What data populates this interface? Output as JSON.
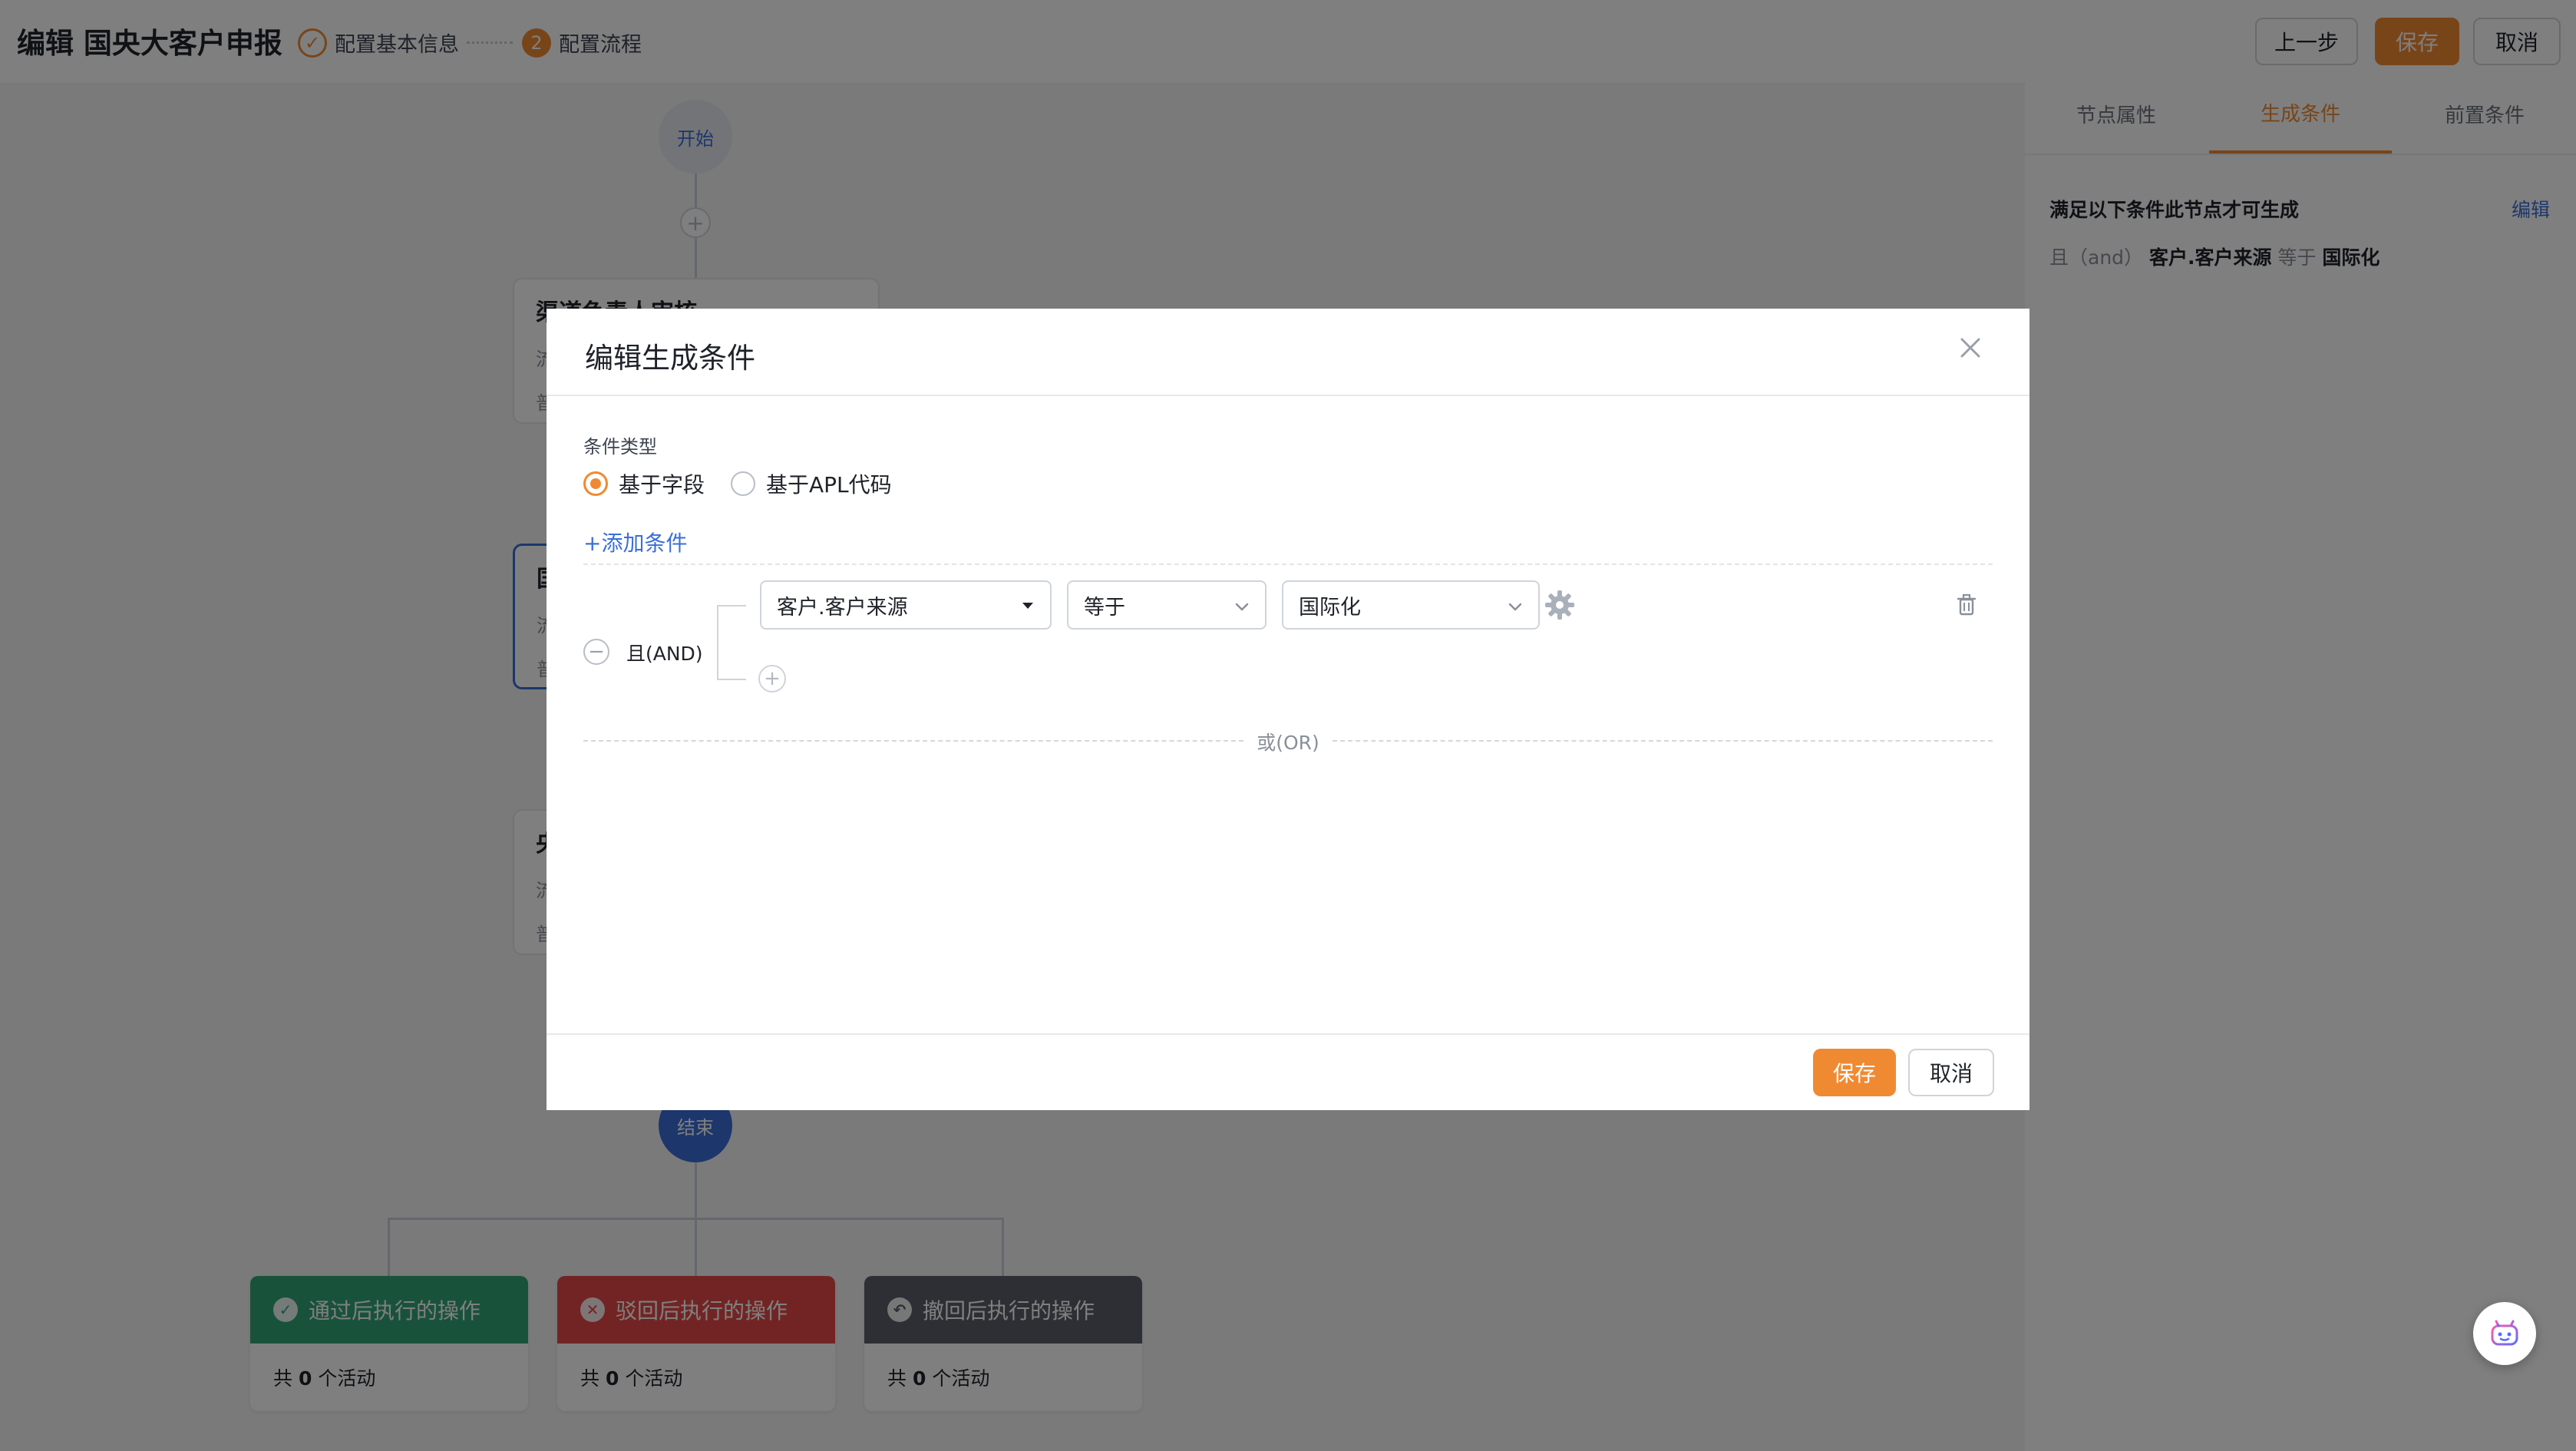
{
  "header": {
    "title": "编辑 国央大客户申报",
    "steps": [
      {
        "label": "配置基本信息",
        "marker": "✓"
      },
      {
        "label": "配置流程",
        "marker": "2"
      }
    ],
    "prev_label": "上一步",
    "save_label": "保存",
    "cancel_label": "取消"
  },
  "flow": {
    "start_label": "开始",
    "plus_label": "+",
    "cards": [
      {
        "title": "渠道负责人审核",
        "line1": "流",
        "line2": "普"
      },
      {
        "title": "国",
        "line1": "流",
        "line2": "普"
      },
      {
        "title": "央",
        "line1": "流",
        "line2": "普"
      }
    ],
    "end_label": "结束",
    "actions": [
      {
        "label": "通过后执行的操作",
        "prefix": "共",
        "count": "0",
        "suffix": "个活动"
      },
      {
        "label": "驳回后执行的操作",
        "prefix": "共",
        "count": "0",
        "suffix": "个活动"
      },
      {
        "label": "撤回后执行的操作",
        "prefix": "共",
        "count": "0",
        "suffix": "个活动"
      }
    ]
  },
  "right_panel": {
    "tabs": [
      "节点属性",
      "生成条件",
      "前置条件"
    ],
    "active_tab": "生成条件",
    "description": "满足以下条件此节点才可生成",
    "edit_label": "编辑",
    "condition": {
      "connector": "且（and）",
      "field": "客户.客户来源",
      "operator": "等于",
      "value": "国际化"
    }
  },
  "modal": {
    "title": "编辑生成条件",
    "condition_type_label": "条件类型",
    "radio_field": "基于字段",
    "radio_apl": "基于APL代码",
    "selected_type": "基于字段",
    "add_condition": "+添加条件",
    "group": {
      "logic_label": "且(AND)",
      "toggle_symbol": "−",
      "rows": [
        {
          "field": "客户.客户来源",
          "operator": "等于",
          "value": "国际化"
        }
      ],
      "add_symbol": "+"
    },
    "or_label": "或(OR)",
    "save_label": "保存",
    "cancel_label": "取消"
  },
  "colors": {
    "accent": "#f08a32",
    "link": "#3a6fd8",
    "approve": "#33a577",
    "reject": "#e54848",
    "withdraw": "#5a5f6a"
  }
}
